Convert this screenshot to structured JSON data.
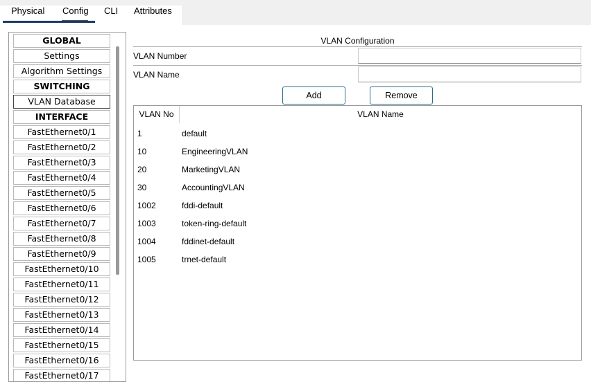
{
  "tabs": [
    {
      "label": "Physical"
    },
    {
      "label": "Config"
    },
    {
      "label": "CLI"
    },
    {
      "label": "Attributes"
    }
  ],
  "sidebar": {
    "items": [
      {
        "label": "GLOBAL",
        "header": true
      },
      {
        "label": "Settings"
      },
      {
        "label": "Algorithm Settings"
      },
      {
        "label": "SWITCHING",
        "header": true
      },
      {
        "label": "VLAN Database",
        "selected": true
      },
      {
        "label": "INTERFACE",
        "header": true
      },
      {
        "label": "FastEthernet0/1"
      },
      {
        "label": "FastEthernet0/2"
      },
      {
        "label": "FastEthernet0/3"
      },
      {
        "label": "FastEthernet0/4"
      },
      {
        "label": "FastEthernet0/5"
      },
      {
        "label": "FastEthernet0/6"
      },
      {
        "label": "FastEthernet0/7"
      },
      {
        "label": "FastEthernet0/8"
      },
      {
        "label": "FastEthernet0/9"
      },
      {
        "label": "FastEthernet0/10"
      },
      {
        "label": "FastEthernet0/11"
      },
      {
        "label": "FastEthernet0/12"
      },
      {
        "label": "FastEthernet0/13"
      },
      {
        "label": "FastEthernet0/14"
      },
      {
        "label": "FastEthernet0/15"
      },
      {
        "label": "FastEthernet0/16"
      },
      {
        "label": "FastEthernet0/17"
      }
    ]
  },
  "config": {
    "title": "VLAN Configuration",
    "vlan_number_label": "VLAN Number",
    "vlan_number_value": "",
    "vlan_name_label": "VLAN Name",
    "vlan_name_value": "",
    "add_label": "Add",
    "remove_label": "Remove"
  },
  "table": {
    "col_no": "VLAN No",
    "col_name": "VLAN Name",
    "rows": [
      {
        "no": "1",
        "name": "default"
      },
      {
        "no": "10",
        "name": "EngineeringVLAN"
      },
      {
        "no": "20",
        "name": "MarketingVLAN"
      },
      {
        "no": "30",
        "name": "AccountingVLAN"
      },
      {
        "no": "1002",
        "name": "fddi-default"
      },
      {
        "no": "1003",
        "name": "token-ring-default"
      },
      {
        "no": "1004",
        "name": "fddinet-default"
      },
      {
        "no": "1005",
        "name": "trnet-default"
      }
    ]
  }
}
